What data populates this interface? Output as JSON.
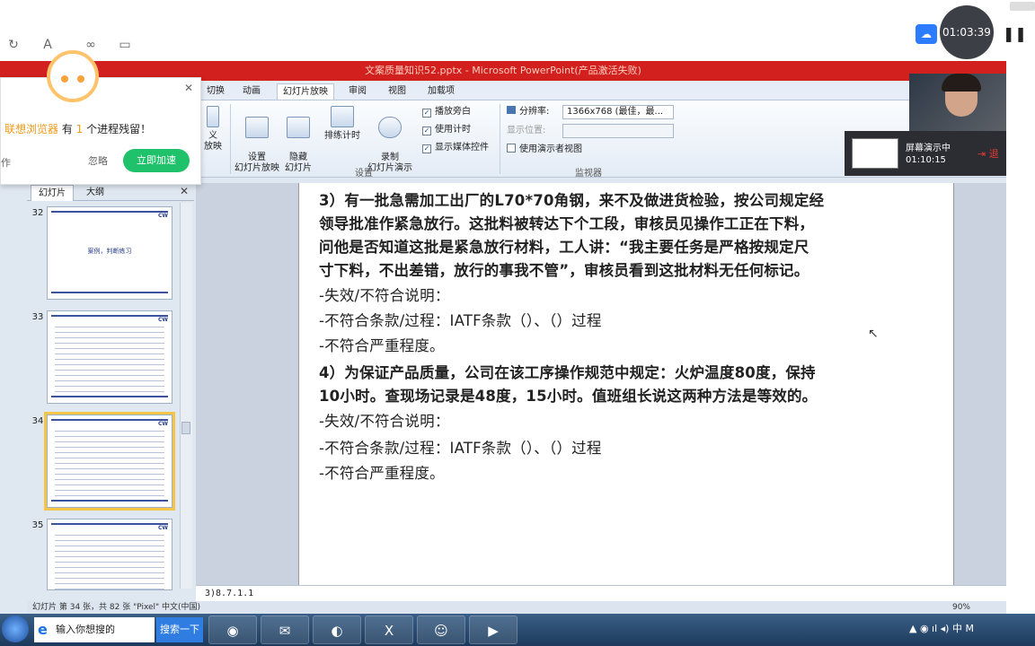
{
  "recorder": {
    "elapsed": "01:03:39",
    "mini_label": "屏幕演示中",
    "mini_time": "01:10:15",
    "mini_stop": "退"
  },
  "ppt": {
    "title": "文案质量知识52.pptx - Microsoft PowerPoint(产品激活失败)",
    "tabs": [
      "切换",
      "动画",
      "幻灯片放映",
      "审阅",
      "视图",
      "加载项"
    ],
    "active_tab": "幻灯片放映",
    "ribbon": {
      "custom_left": "义",
      "custom_left2": "放映",
      "setup_btn": "设置\n幻灯片放映",
      "hide_btn": "隐藏\n幻灯片",
      "rehearse_btn": "排练计时",
      "record_btn": "录制\n幻灯片演示",
      "checks": [
        "播放旁白",
        "使用计时",
        "显示媒体控件"
      ],
      "group_setup": "设置",
      "resolution_label": "分辨率:",
      "resolution_value": "1366x768 (最佳，最...",
      "display_label": "显示位置:",
      "presenter_view": "使用演示者视图",
      "group_monitor": "监视器"
    },
    "pane_tabs": [
      "幻灯片",
      "大纲"
    ],
    "thumbs": [
      {
        "num": "32",
        "title": "案例，判断练习",
        "logo": "CW"
      },
      {
        "num": "33",
        "logo": "CW"
      },
      {
        "num": "34",
        "logo": "CW"
      },
      {
        "num": "35",
        "logo": "CW"
      }
    ],
    "slide_lines": [
      "3）有一批急需加工出厂的L70*70角钢，来不及做进货检验，按公司规定经",
      "领导批准作紧急放行。这批料被转达下个工段，审核员见操作工正在下料，",
      "问他是否知道这批是紧急放行材料，工人讲：“我主要任务是严格按规定尺",
      "寸下料，不出差错，放行的事我不管”，审核员看到这批材料无任何标记。",
      "-失效/不符合说明：",
      "-不符合条款/过程：IATF条款（）、（）过程",
      "-不符合严重程度。",
      "4）为保证产品质量，公司在该工序操作规范中规定：火炉温度80度，保持",
      "10小时。查现场记录是48度，15小时。值班组长说这两种方法是等效的。",
      "-失效/不符合说明：",
      "-不符合条款/过程：IATF条款（）、（）过程",
      "-不符合严重程度。"
    ],
    "notes": "3)8.7.1.1",
    "status": "幻灯片 第 34 张，共 82 张   \"Pixel\"   中文(中国)",
    "zoom": "90%"
  },
  "popup": {
    "brand": "联想浏览器",
    "msg_mid": " 有 ",
    "count": "1",
    "msg_end": " 个进程残留！",
    "left_text": "作",
    "ignore": "忽略",
    "action": "立即加速"
  },
  "taskbar": {
    "search_placeholder": "输入你想搜的",
    "search_go": "搜索一下",
    "tray": "▲  ◉  ıl  ◂)  中  M"
  }
}
